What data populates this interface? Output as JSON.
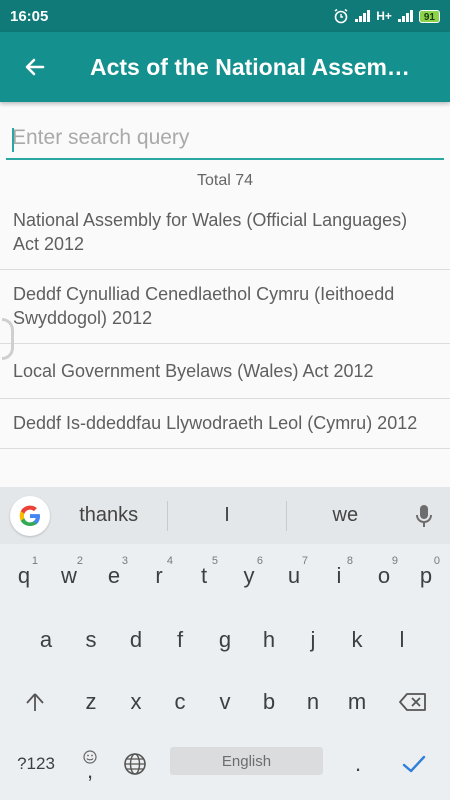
{
  "status_bar": {
    "time": "16:05",
    "network": "H+",
    "battery": "91"
  },
  "app_bar": {
    "title": "Acts of the National Assem…"
  },
  "search": {
    "placeholder": "Enter search query"
  },
  "total_label": "Total 74",
  "list": {
    "items": [
      "National Assembly for Wales (Official Languages) Act 2012",
      "Deddf Cynulliad Cenedlaethol Cymru (Ieithoedd Swyddogol) 2012",
      "Local Government Byelaws (Wales) Act 2012",
      "Deddf Is-ddeddfau Llywodraeth Leol (Cymru) 2012"
    ]
  },
  "keyboard": {
    "suggestions": [
      "thanks",
      "I",
      "we"
    ],
    "row1": [
      "q",
      "w",
      "e",
      "r",
      "t",
      "y",
      "u",
      "i",
      "o",
      "p"
    ],
    "row1_hints": [
      "1",
      "2",
      "3",
      "4",
      "5",
      "6",
      "7",
      "8",
      "9",
      "0"
    ],
    "row2": [
      "a",
      "s",
      "d",
      "f",
      "g",
      "h",
      "j",
      "k",
      "l"
    ],
    "row3": [
      "z",
      "x",
      "c",
      "v",
      "b",
      "n",
      "m"
    ],
    "symbols_key": "?123",
    "comma_key": ",",
    "period_key": ".",
    "space_label": "English",
    "accent_color": "#14908e"
  }
}
